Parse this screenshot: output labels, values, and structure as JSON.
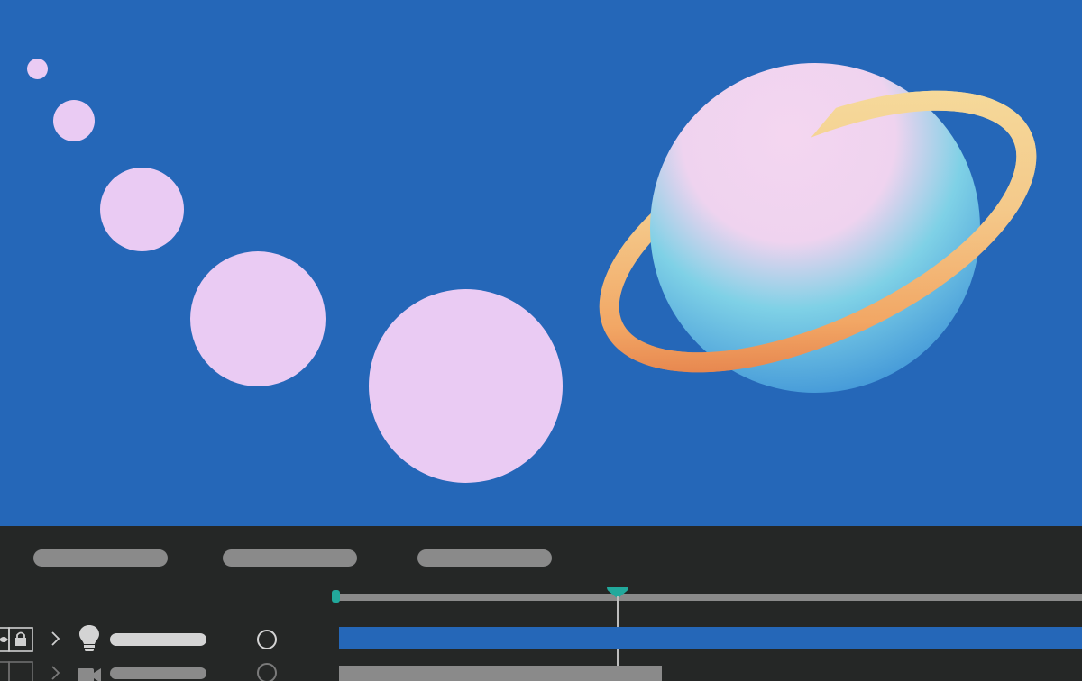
{
  "app": {
    "name": "",
    "canvas_background": "#2567b8",
    "panel_background": "#252726"
  },
  "composition": {
    "dots_color": "#eacbf3",
    "dot_count": 5,
    "planet": {
      "body_colors": [
        "#f4d6f0",
        "#7fd1e6",
        "#3a8fd6"
      ],
      "ring_colors": [
        "#f6dfa0",
        "#f2a765",
        "#de6b3c"
      ]
    }
  },
  "timeline": {
    "tab_count": 3,
    "tab_color": "#8a8a8a",
    "accent": "#22a99c",
    "playhead_progress": 0.38,
    "layers": [
      {
        "type_icon": "light-bulb-icon",
        "bar_color": "#2567b8",
        "name_pill_color": "#d4d4d4",
        "visible": true,
        "locked": true
      },
      {
        "type_icon": "camera-icon",
        "bar_color": "#8a8a8a",
        "name_pill_color": "#8a8a8a",
        "visible": false,
        "locked": false
      }
    ]
  }
}
